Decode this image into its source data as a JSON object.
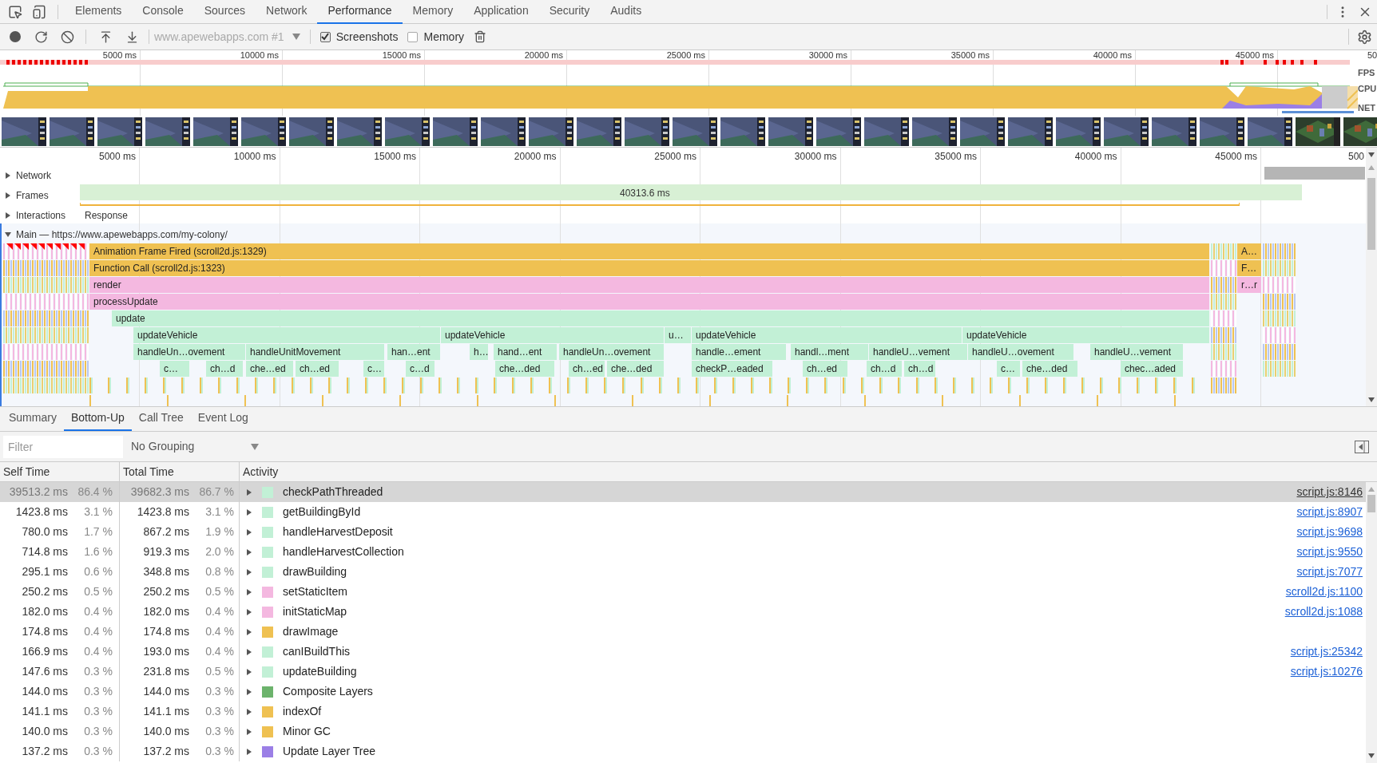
{
  "devtools_tabs": [
    {
      "label": "Elements",
      "selected": false
    },
    {
      "label": "Console",
      "selected": false
    },
    {
      "label": "Sources",
      "selected": false
    },
    {
      "label": "Network",
      "selected": false
    },
    {
      "label": "Performance",
      "selected": true
    },
    {
      "label": "Memory",
      "selected": false
    },
    {
      "label": "Application",
      "selected": false
    },
    {
      "label": "Security",
      "selected": false
    },
    {
      "label": "Audits",
      "selected": false
    }
  ],
  "toolbar": {
    "profile_select": "www.apewebapps.com #1",
    "checkboxes": [
      {
        "label": "Screenshots",
        "checked": true
      },
      {
        "label": "Memory",
        "checked": false
      }
    ]
  },
  "overview": {
    "time_labels": [
      "5000 ms",
      "10000 ms",
      "15000 ms",
      "20000 ms",
      "25000 ms",
      "30000 ms",
      "35000 ms",
      "40000 ms",
      "45000 ms",
      "50"
    ],
    "track_labels": [
      "FPS",
      "CPU",
      "NET"
    ]
  },
  "timeline": {
    "time_labels": [
      "5000 ms",
      "10000 ms",
      "15000 ms",
      "20000 ms",
      "25000 ms",
      "30000 ms",
      "35000 ms",
      "40000 ms",
      "45000 ms",
      "500"
    ],
    "tracks": [
      {
        "label": "Network",
        "expanded": false
      },
      {
        "label": "Frames",
        "expanded": false
      },
      {
        "label": "Interactions",
        "expanded": false
      }
    ],
    "frame_duration": "40313.6 ms",
    "interaction": "Response",
    "main": {
      "label": "Main — https://www.apewebapps.com/my-colony/",
      "expanded": true
    },
    "flame_rows": [
      {
        "color": "#efc152",
        "blocks": [
          "Animation Frame Fired (scroll2d.js:1329)",
          "A…"
        ]
      },
      {
        "color": "#efc152",
        "blocks": [
          "Function Call (scroll2d.js:1323)",
          "F…"
        ]
      },
      {
        "color": "#f4b8e0",
        "blocks": [
          "render",
          "r…r"
        ]
      },
      {
        "color": "#f4b8e0",
        "blocks": [
          "processUpdate"
        ]
      },
      {
        "color": "#c2f0d6",
        "blocks": [
          "update"
        ]
      },
      {
        "color": "#c2f0d6",
        "blocks": [
          "updateVehicle",
          "updateVehicle",
          "u…",
          "updateVehicle",
          "updateVehicle"
        ]
      },
      {
        "color": "#c2f0d6",
        "blocks": [
          "handleUn…ovement",
          "handleUnitMovement",
          "han…ent",
          "h…",
          "hand…ent",
          "handleUn…ovement",
          "handle…ement",
          "handl…ment",
          "handleU…vement",
          "handleU…ovement",
          "handleU…vement"
        ]
      },
      {
        "color": "#c2f0d6",
        "blocks": [
          "c…",
          "ch…d",
          "che…ed",
          "ch…ed",
          "c…",
          "c…d",
          "che…ded",
          "ch…ed",
          "che…ded",
          "checkP…eaded",
          "ch…ed",
          "ch…d",
          "ch…d",
          "c…",
          "che…ded",
          "chec…aded"
        ]
      }
    ]
  },
  "details": {
    "tabs": [
      {
        "label": "Summary",
        "selected": false
      },
      {
        "label": "Bottom-Up",
        "selected": true
      },
      {
        "label": "Call Tree",
        "selected": false
      },
      {
        "label": "Event Log",
        "selected": false
      }
    ],
    "filter": {
      "placeholder": "Filter"
    },
    "grouping": "No Grouping",
    "columns": [
      "Self Time",
      "Total Time",
      "Activity"
    ],
    "rows": [
      {
        "self_time": "39513.2 ms",
        "self_pct": "86.4 %",
        "total_time": "39682.3 ms",
        "total_pct": "86.7 %",
        "activity": "checkPathThreaded",
        "color": "#c2f0d6",
        "link": "script.js:8146",
        "selected": true
      },
      {
        "self_time": "1423.8 ms",
        "self_pct": "3.1 %",
        "total_time": "1423.8 ms",
        "total_pct": "3.1 %",
        "activity": "getBuildingById",
        "color": "#c2f0d6",
        "link": "script.js:8907",
        "selected": false
      },
      {
        "self_time": "780.0 ms",
        "self_pct": "1.7 %",
        "total_time": "867.2 ms",
        "total_pct": "1.9 %",
        "activity": "handleHarvestDeposit",
        "color": "#c2f0d6",
        "link": "script.js:9698",
        "selected": false
      },
      {
        "self_time": "714.8 ms",
        "self_pct": "1.6 %",
        "total_time": "919.3 ms",
        "total_pct": "2.0 %",
        "activity": "handleHarvestCollection",
        "color": "#c2f0d6",
        "link": "script.js:9550",
        "selected": false
      },
      {
        "self_time": "295.1 ms",
        "self_pct": "0.6 %",
        "total_time": "348.8 ms",
        "total_pct": "0.8 %",
        "activity": "drawBuilding",
        "color": "#c2f0d6",
        "link": "script.js:7077",
        "selected": false
      },
      {
        "self_time": "250.2 ms",
        "self_pct": "0.5 %",
        "total_time": "250.2 ms",
        "total_pct": "0.5 %",
        "activity": "setStaticItem",
        "color": "#f4b8e0",
        "link": "scroll2d.js:1100",
        "selected": false
      },
      {
        "self_time": "182.0 ms",
        "self_pct": "0.4 %",
        "total_time": "182.0 ms",
        "total_pct": "0.4 %",
        "activity": "initStaticMap",
        "color": "#f4b8e0",
        "link": "scroll2d.js:1088",
        "selected": false
      },
      {
        "self_time": "174.8 ms",
        "self_pct": "0.4 %",
        "total_time": "174.8 ms",
        "total_pct": "0.4 %",
        "activity": "drawImage",
        "color": "#efc152",
        "selected": false
      },
      {
        "self_time": "166.9 ms",
        "self_pct": "0.4 %",
        "total_time": "193.0 ms",
        "total_pct": "0.4 %",
        "activity": "canIBuildThis",
        "color": "#c2f0d6",
        "link": "script.js:25342",
        "selected": false
      },
      {
        "self_time": "147.6 ms",
        "self_pct": "0.3 %",
        "total_time": "231.8 ms",
        "total_pct": "0.5 %",
        "activity": "updateBuilding",
        "color": "#c2f0d6",
        "link": "script.js:10276",
        "selected": false
      },
      {
        "self_time": "144.0 ms",
        "self_pct": "0.3 %",
        "total_time": "144.0 ms",
        "total_pct": "0.3 %",
        "activity": "Composite Layers",
        "color": "#6cb36c",
        "selected": false
      },
      {
        "self_time": "141.1 ms",
        "self_pct": "0.3 %",
        "total_time": "141.1 ms",
        "total_pct": "0.3 %",
        "activity": "indexOf",
        "color": "#efc152",
        "selected": false
      },
      {
        "self_time": "140.0 ms",
        "self_pct": "0.3 %",
        "total_time": "140.0 ms",
        "total_pct": "0.3 %",
        "activity": "Minor GC",
        "color": "#efc152",
        "selected": false
      },
      {
        "self_time": "137.2 ms",
        "self_pct": "0.3 %",
        "total_time": "137.2 ms",
        "total_pct": "0.3 %",
        "activity": "Update Layer Tree",
        "color": "#9b7fe6",
        "selected": false
      }
    ]
  }
}
